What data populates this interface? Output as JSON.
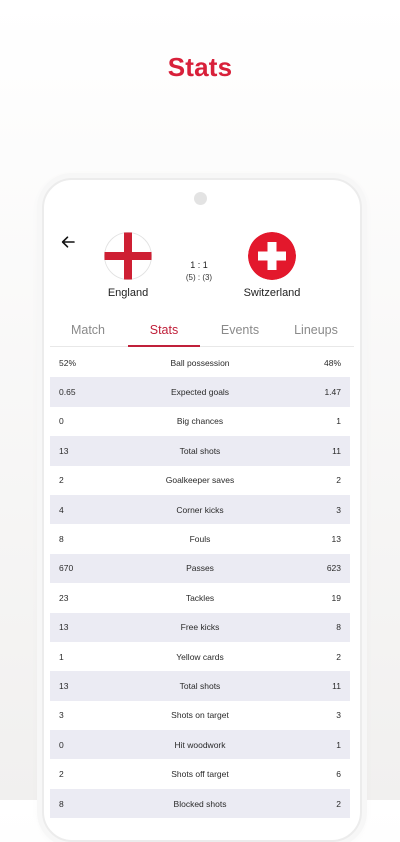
{
  "promo": {
    "title": "Stats"
  },
  "match": {
    "home": {
      "name": "England"
    },
    "away": {
      "name": "Switzerland"
    },
    "score": "1 : 1",
    "penalties": "(5) : (3)"
  },
  "tabs": [
    {
      "label": "Match"
    },
    {
      "label": "Stats"
    },
    {
      "label": "Events"
    },
    {
      "label": "Lineups"
    }
  ],
  "active_tab": "Stats",
  "colors": {
    "accent": "#c0203a",
    "promo_title": "#d8203a",
    "row_shade": "#ebebf3"
  },
  "stats": [
    {
      "home": "52%",
      "label": "Ball possession",
      "away": "48%"
    },
    {
      "home": "0.65",
      "label": "Expected goals",
      "away": "1.47"
    },
    {
      "home": "0",
      "label": "Big chances",
      "away": "1"
    },
    {
      "home": "13",
      "label": "Total shots",
      "away": "11"
    },
    {
      "home": "2",
      "label": "Goalkeeper saves",
      "away": "2"
    },
    {
      "home": "4",
      "label": "Corner kicks",
      "away": "3"
    },
    {
      "home": "8",
      "label": "Fouls",
      "away": "13"
    },
    {
      "home": "670",
      "label": "Passes",
      "away": "623"
    },
    {
      "home": "23",
      "label": "Tackles",
      "away": "19"
    },
    {
      "home": "13",
      "label": "Free kicks",
      "away": "8"
    },
    {
      "home": "1",
      "label": "Yellow cards",
      "away": "2"
    },
    {
      "home": "13",
      "label": "Total shots",
      "away": "11"
    },
    {
      "home": "3",
      "label": "Shots on target",
      "away": "3"
    },
    {
      "home": "0",
      "label": "Hit woodwork",
      "away": "1"
    },
    {
      "home": "2",
      "label": "Shots off target",
      "away": "6"
    },
    {
      "home": "8",
      "label": "Blocked shots",
      "away": "2"
    }
  ]
}
